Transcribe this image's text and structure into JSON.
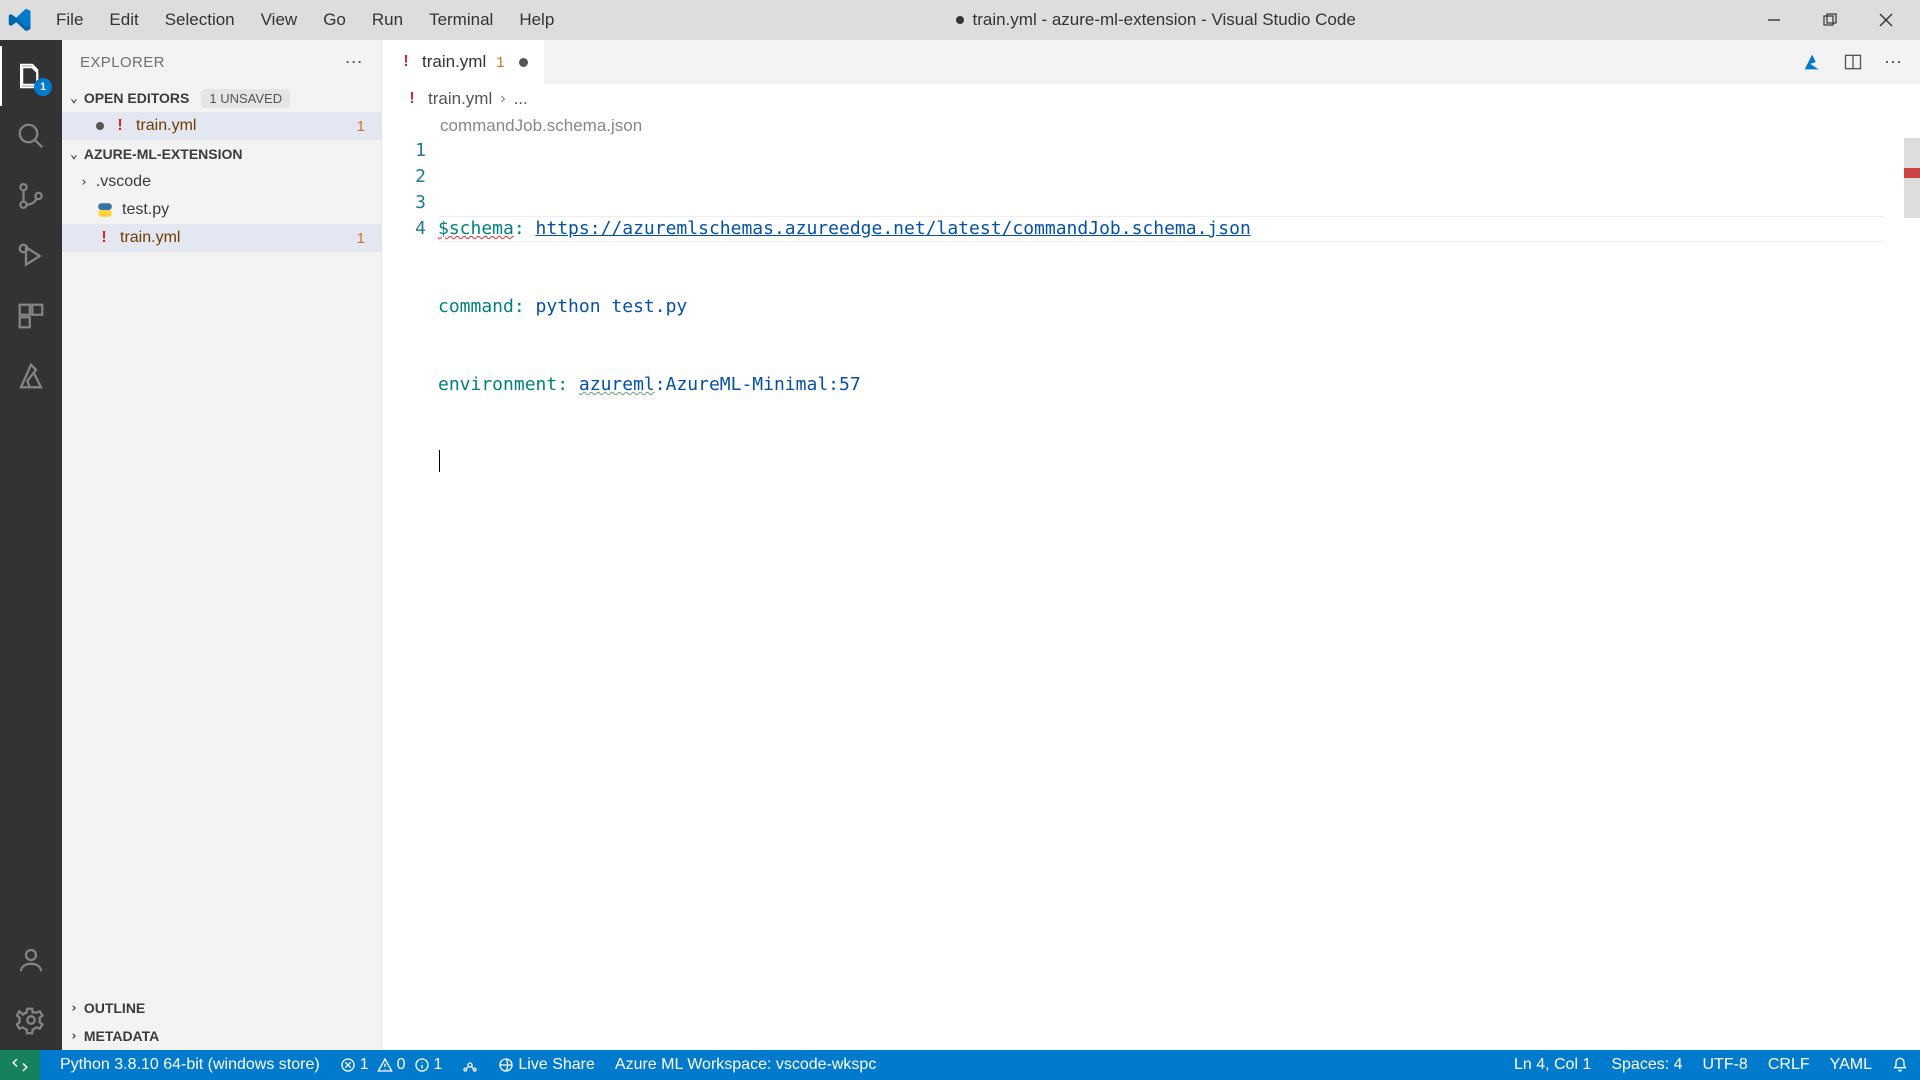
{
  "window": {
    "title": "train.yml - azure-ml-extension - Visual Studio Code",
    "modified": true
  },
  "menu": {
    "items": [
      "File",
      "Edit",
      "Selection",
      "View",
      "Go",
      "Run",
      "Terminal",
      "Help"
    ]
  },
  "activity": {
    "explorer_badge": "1"
  },
  "explorer": {
    "title": "EXPLORER",
    "open_editors": {
      "label": "OPEN EDITORS",
      "unsaved_badge": "1 UNSAVED",
      "items": [
        {
          "name": "train.yml",
          "modified": true,
          "problems": "1",
          "icon": "yaml"
        }
      ]
    },
    "folder": {
      "label": "AZURE-ML-EXTENSION",
      "items": [
        {
          "name": ".vscode",
          "kind": "folder",
          "open": false
        },
        {
          "name": "test.py",
          "kind": "file",
          "icon": "python"
        },
        {
          "name": "train.yml",
          "kind": "file",
          "icon": "yaml",
          "problems": "1",
          "active": true
        }
      ]
    },
    "outline_label": "OUTLINE",
    "metadata_label": "METADATA"
  },
  "editor": {
    "tab": {
      "name": "train.yml",
      "problems": "1",
      "modified": true
    },
    "breadcrumb": {
      "file": "train.yml",
      "rest": "..."
    },
    "schema_hint": "commandJob.schema.json",
    "lines": [
      {
        "n": "1",
        "key": "$schema",
        "sep": ":",
        "val": "https://azuremlschemas.azureedge.net/latest/commandJob.schema.json",
        "link": true
      },
      {
        "n": "2",
        "key": "command",
        "sep": ":",
        "val": "python test.py"
      },
      {
        "n": "3",
        "key": "environment",
        "sep": ":",
        "val_pre": "azureml",
        "val_post": ":AzureML-Minimal:57",
        "squiggle": true
      },
      {
        "n": "4"
      }
    ]
  },
  "status": {
    "python": "Python 3.8.10 64-bit (windows store)",
    "err_count": "1",
    "warn_count": "0",
    "info_count": "1",
    "liveshare": "Live Share",
    "workspace": "Azure ML Workspace: vscode-wkspc",
    "cursor": "Ln 4, Col 1",
    "spaces": "Spaces: 4",
    "encoding": "UTF-8",
    "eol": "CRLF",
    "lang": "YAML"
  }
}
